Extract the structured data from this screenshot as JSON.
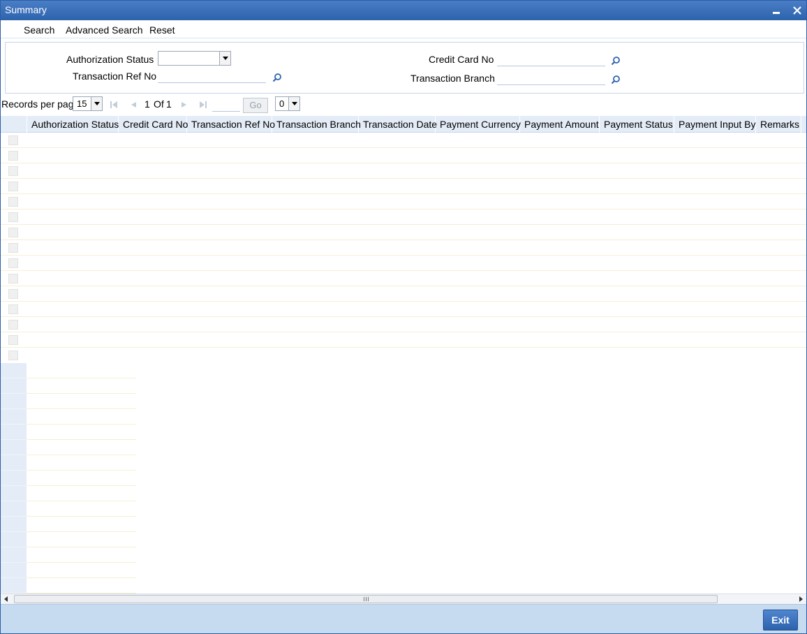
{
  "window": {
    "title": "Summary"
  },
  "toolbar": {
    "search": "Search",
    "advanced_search": "Advanced Search",
    "reset": "Reset"
  },
  "criteria": {
    "authorization_status_label": "Authorization Status",
    "authorization_status_value": "",
    "transaction_ref_no_label": "Transaction Ref No",
    "transaction_ref_no_value": "",
    "credit_card_no_label": "Credit Card No",
    "credit_card_no_value": "",
    "transaction_branch_label": "Transaction Branch",
    "transaction_branch_value": ""
  },
  "pager": {
    "records_per_page_label": "Records per page",
    "records_per_page_value": "15",
    "page_current": "1",
    "page_of": "Of",
    "page_total": "1",
    "go_label": "Go",
    "go_page_value": "",
    "extra_select_value": "0"
  },
  "grid": {
    "columns": [
      "Authorization Status",
      "Credit Card No",
      "Transaction Ref No",
      "Transaction Branch",
      "Transaction Date",
      "Payment Currency",
      "Payment Amount",
      "Payment Status",
      "Payment Input By",
      "Remarks"
    ]
  },
  "footer": {
    "exit_label": "Exit"
  },
  "colors": {
    "title_bar": "#2d62ad",
    "header_bg": "#e4ecf7",
    "footer_bg": "#c6daf0"
  },
  "icons": [
    "close-icon",
    "minimize-icon",
    "lookup-icon",
    "first-page-icon",
    "previous-page-icon",
    "next-page-icon",
    "last-page-icon",
    "dropdown-arrow-icon"
  ]
}
